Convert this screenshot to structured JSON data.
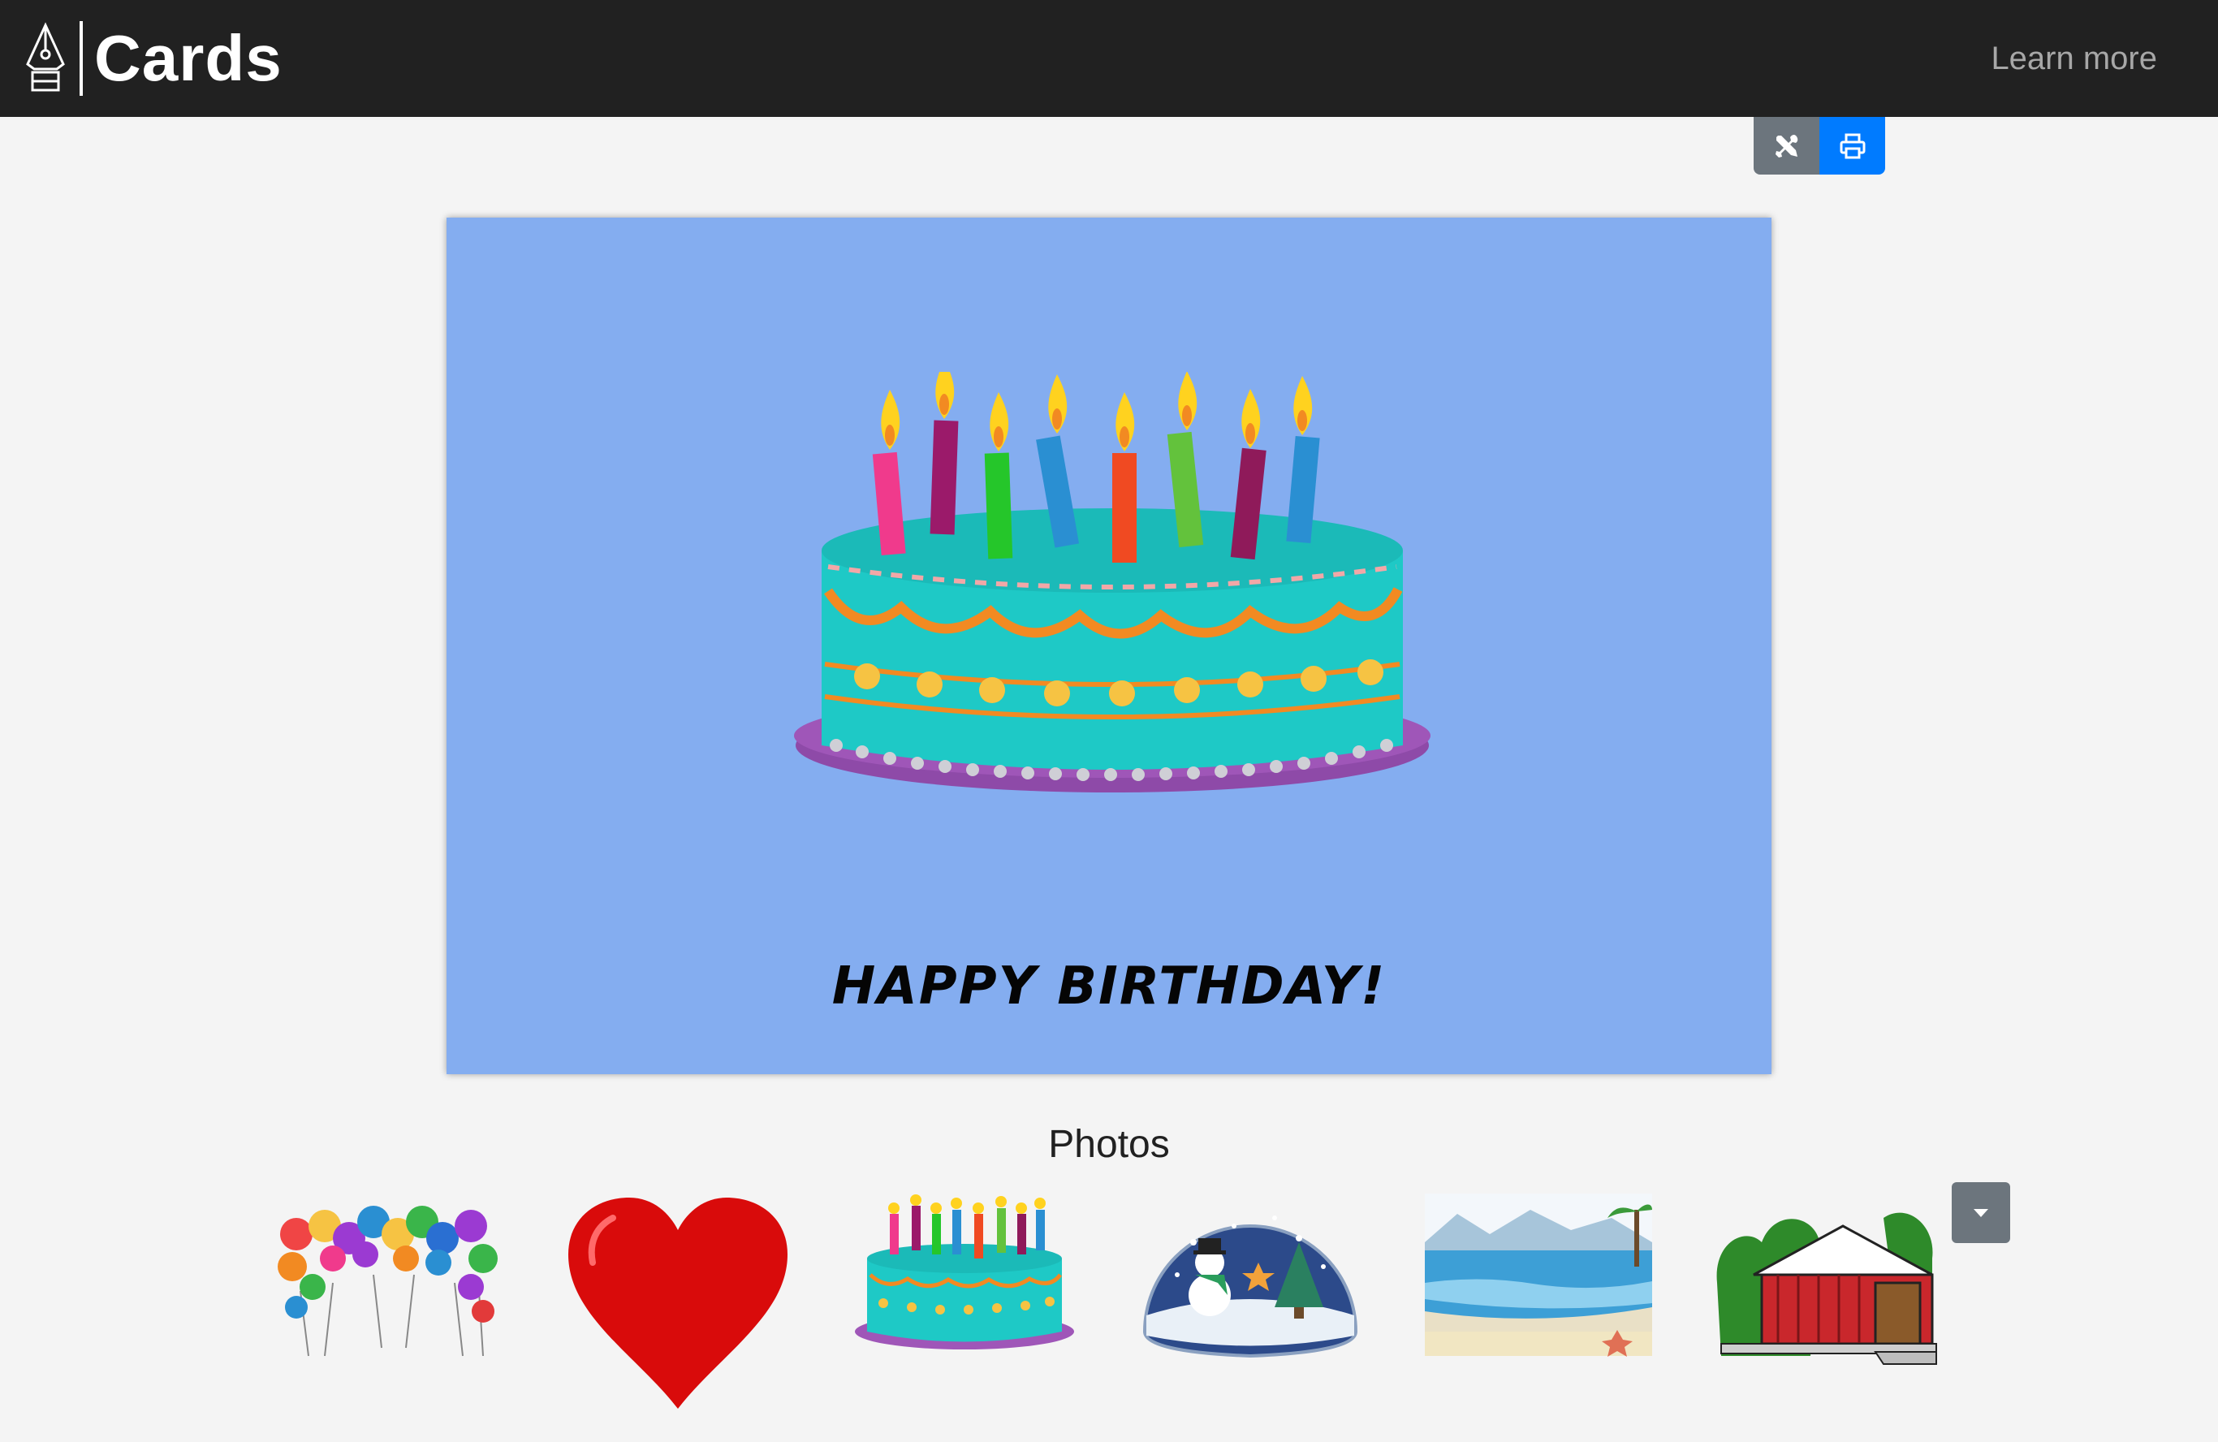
{
  "app": {
    "title": "Cards",
    "learn_more_label": "Learn more"
  },
  "toolbar": {
    "tools_icon": "tools-icon",
    "print_icon": "printer-icon"
  },
  "card": {
    "background_color": "#84adf0",
    "image": "birthday-cake",
    "message": "HAPPY BIRTHDAY!"
  },
  "photos": {
    "heading": "Photos",
    "items": [
      {
        "name": "balloons"
      },
      {
        "name": "heart"
      },
      {
        "name": "birthday-cake"
      },
      {
        "name": "snow-globe"
      },
      {
        "name": "beach"
      },
      {
        "name": "covered-bridge"
      }
    ],
    "more_icon": "caret-down-icon"
  },
  "colors": {
    "navbar": "#212121",
    "page_background": "#f4f4f4",
    "print_button": "#007bff",
    "tools_button": "#6c757d"
  }
}
